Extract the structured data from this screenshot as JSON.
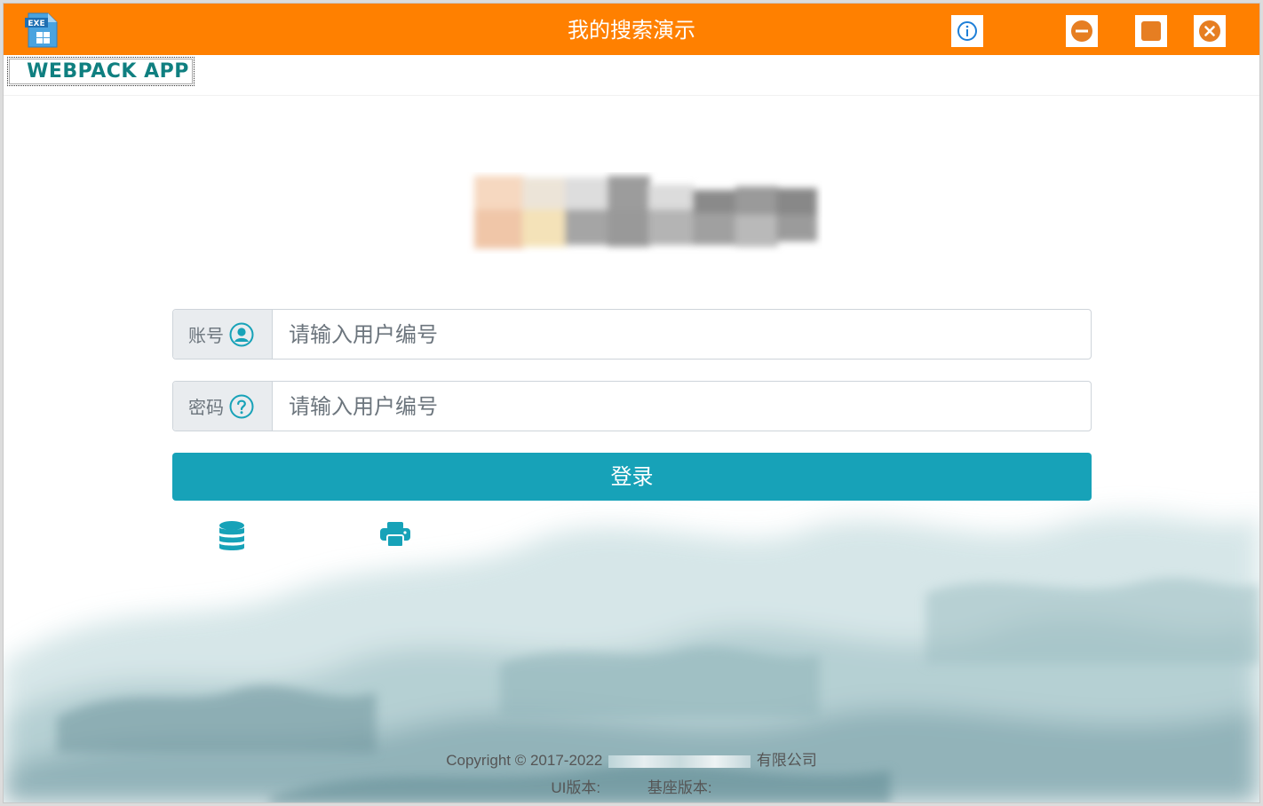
{
  "window": {
    "title": "我的搜索演示",
    "app_icon_label": "EXE"
  },
  "titlebar_buttons": {
    "info_icon": "info-icon",
    "minimize_icon": "minus-circle-icon",
    "maximize_icon": "square-icon",
    "close_icon": "close-circle-icon"
  },
  "tab": {
    "label": "WEBPACK APP"
  },
  "login": {
    "user_label": "账号",
    "user_icon": "user-circle-icon",
    "user_placeholder": "请输入用户编号",
    "pass_label": "密码",
    "pass_icon": "question-circle-icon",
    "pass_placeholder": "请输入用户编号",
    "submit_label": "登录"
  },
  "tools": {
    "database_icon": "database-icon",
    "printer_icon": "printer-icon"
  },
  "footer": {
    "copyright_prefix": "Copyright © 2017-2022",
    "copyright_suffix": "有限公司",
    "ui_version_label": "UI版本:",
    "base_version_label": "基座版本:"
  },
  "colors": {
    "titlebar": "#ff8000",
    "accent": "#17a2b8",
    "tab_text": "#0f7f80"
  }
}
